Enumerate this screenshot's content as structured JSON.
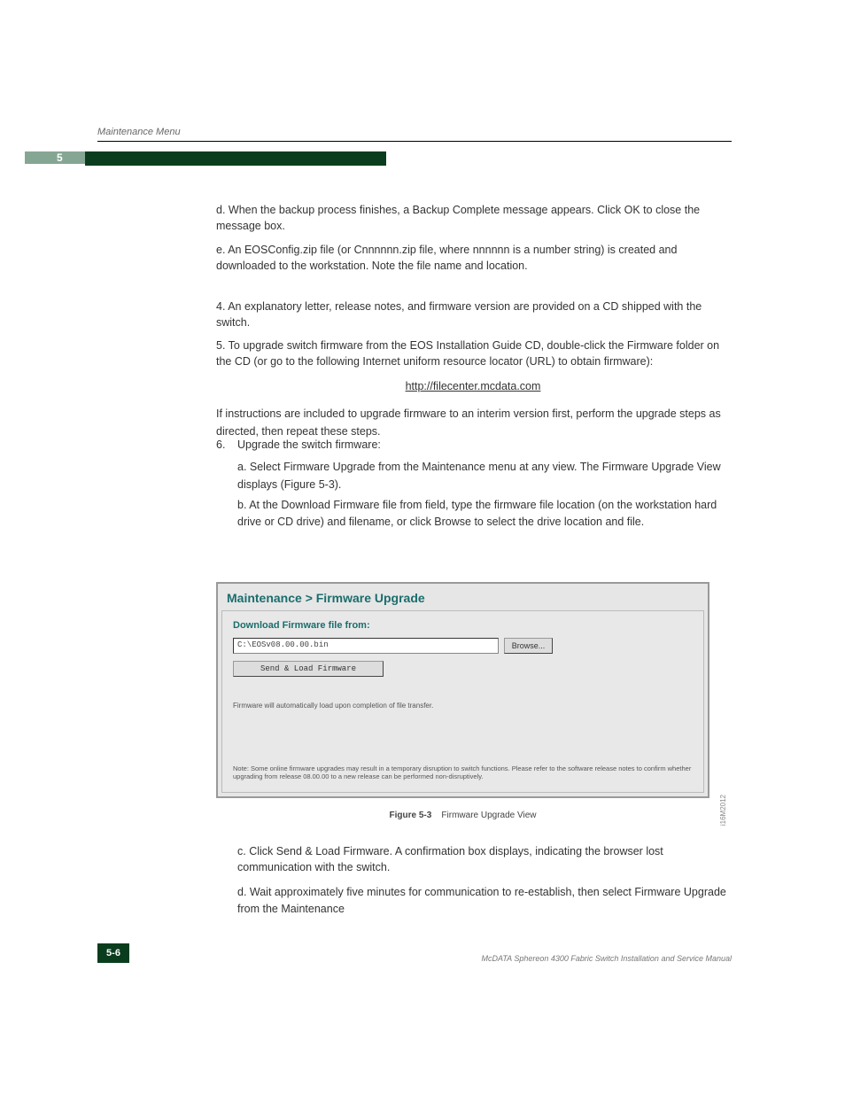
{
  "page": {
    "section_number": "5",
    "running_head": "Maintenance Menu",
    "page_number": "5-6",
    "footer": "McDATA Sphereon 4300 Fabric Switch Installation and Service Manual"
  },
  "paragraphs": {
    "p1": "d. When the backup process finishes, a Backup Complete message appears. Click OK to close the message box.",
    "p2": "e. An EOSConfig.zip file (or Cnnnnnn.zip file, where nnnnnn is a number string) is created and downloaded to the workstation. Note the file name and location.",
    "p3": "4. An explanatory letter, release notes, and firmware version are provided on a CD shipped with the switch.",
    "p4": "5. To upgrade switch firmware from the EOS Installation Guide CD, double-click the Firmware folder on the CD (or go to the following Internet uniform resource locator (URL) to obtain firmware):",
    "url": "http://filecenter.mcdata.com",
    "step1_body": "If instructions are included to upgrade firmware to an interim version first, perform the upgrade steps as directed, then repeat these steps.",
    "step2_head": "Upgrade the switch firmware:",
    "step2_a": "a. Select Firmware Upgrade from the Maintenance menu at any view. The Firmware Upgrade View displays (Figure 5-3).",
    "step3": "b. At the Download Firmware file from field, type the firmware file location (on the workstation hard drive or CD drive) and filename, or click Browse to select the drive location and file.",
    "pa1": "c. Click Send & Load Firmware. A confirmation box displays, indicating the browser lost communication with the switch.",
    "step5": "d. Wait approximately five minutes for communication to re-establish, then select Firmware Upgrade from the Maintenance"
  },
  "figure": {
    "title": "Maintenance > Firmware Upgrade",
    "sub": "Download Firmware file from:",
    "path_value": "C:\\EOSv08.00.00.bin",
    "browse": "Browse...",
    "send": "Send & Load Firmware",
    "msg1": "Firmware will automatically load upon completion of file transfer.",
    "note": "Note: Some online firmware upgrades may result in a temporary disruption to switch functions. Please refer to the software release notes to confirm whether upgrading from release 08.00.00 to a new release can be performed non-disruptively.",
    "side_label": "i16M2012",
    "caption_label": "Figure 5-3",
    "caption_text": "Firmware Upgrade View"
  }
}
